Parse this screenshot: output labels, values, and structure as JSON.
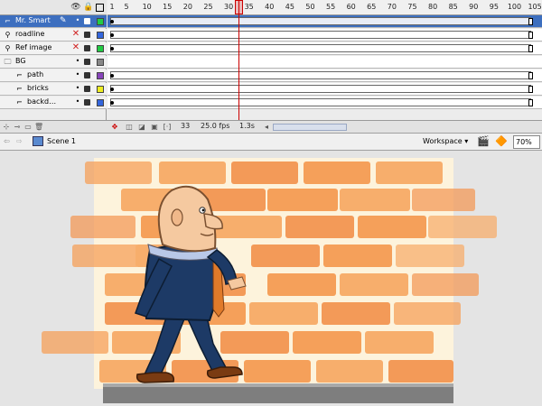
{
  "timeline": {
    "layers": [
      {
        "name": "Mr. Smart",
        "selected": true,
        "color": "#22cc44",
        "type": "layer",
        "indent": false
      },
      {
        "name": "roadline",
        "selected": false,
        "color": "#3366dd",
        "type": "guide",
        "indent": false,
        "hidden": true
      },
      {
        "name": "Ref image",
        "selected": false,
        "color": "#22cc44",
        "type": "guide",
        "indent": false,
        "hidden": true
      },
      {
        "name": "BG",
        "selected": false,
        "color": "#888888",
        "type": "folder",
        "indent": false
      },
      {
        "name": "path",
        "selected": false,
        "color": "#8844bb",
        "type": "layer",
        "indent": true
      },
      {
        "name": "bricks",
        "selected": false,
        "color": "#eeee22",
        "type": "layer",
        "indent": true
      },
      {
        "name": "backd…",
        "selected": false,
        "color": "#3366dd",
        "type": "layer",
        "indent": true
      }
    ],
    "ruler_ticks": [
      "1",
      "5",
      "10",
      "15",
      "20",
      "25",
      "30",
      "35",
      "40",
      "45",
      "50",
      "55",
      "60",
      "65",
      "70",
      "75",
      "80",
      "85",
      "90",
      "95",
      "100",
      "105"
    ],
    "current_frame": "33",
    "fps": "25.0 fps",
    "elapsed": "1.3s"
  },
  "editbar": {
    "scene": "Scene 1",
    "workspace": "Workspace ▾",
    "zoom": "70%"
  },
  "colors": {
    "selection": "#3d6fbf",
    "playhead": "#cc0000",
    "brick": "#f5a05a",
    "stage_bg": "#fdf3dc",
    "suit": "#1d3a66"
  }
}
